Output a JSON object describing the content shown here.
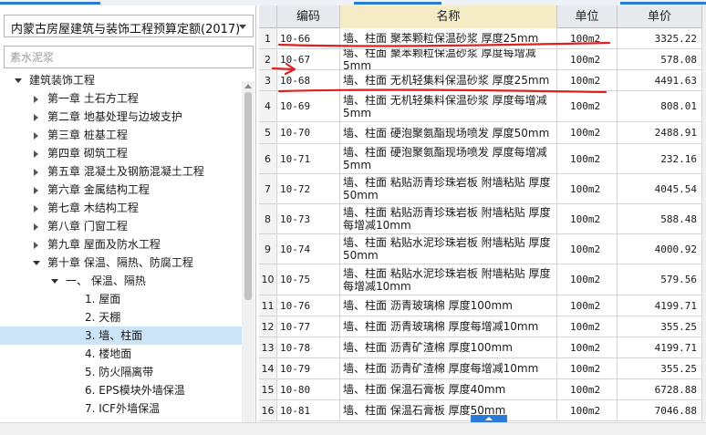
{
  "quota_selector": {
    "value": "内蒙古房屋建筑与装饰工程预算定额(2017)"
  },
  "search": {
    "placeholder": "素水泥浆"
  },
  "tree": {
    "root": "建筑装饰工程",
    "chapters": [
      "第一章 土石方工程",
      "第二章 地基处理与边坡支护",
      "第三章 桩基工程",
      "第四章 砌筑工程",
      "第五章 混凝土及钢筋混凝土工程",
      "第六章 金属结构工程",
      "第七章 木结构工程",
      "第八章 门窗工程",
      "第九章 屋面及防水工程",
      "第十章 保温、隔热、防腐工程"
    ],
    "section": "一、 保温、隔热",
    "items": [
      "1. 屋面",
      "2. 天棚",
      "3. 墙、柱面",
      "4. 楼地面",
      "5. 防火隔离带",
      "6. EPS模块外墙保温",
      "7. ICF外墙保温"
    ]
  },
  "grid": {
    "headers": {
      "code": "编码",
      "name": "名称",
      "unit": "单位",
      "price": "单价"
    },
    "rows": [
      {
        "idx": "1",
        "code": "10-66",
        "name": "墙、柱面 聚苯颗粒保温砂浆 厚度25mm",
        "unit": "100m2",
        "price": "3325.22"
      },
      {
        "idx": "2",
        "code": "10-67",
        "name": "墙、柱面 聚苯颗粒保温砂浆 厚度每增减5mm",
        "unit": "100m2",
        "price": "578.08"
      },
      {
        "idx": "3",
        "code": "10-68",
        "name": "墙、柱面 无机轻集料保温砂浆 厚度25mm",
        "unit": "100m2",
        "price": "4491.63"
      },
      {
        "idx": "4",
        "code": "10-69",
        "name": "墙、柱面 无机轻集料保温砂浆 厚度每增减5mm",
        "unit": "100m2",
        "price": "808.01"
      },
      {
        "idx": "5",
        "code": "10-70",
        "name": "墙、柱面 硬泡聚氨酯现场喷发 厚度50mm",
        "unit": "100m2",
        "price": "2488.91"
      },
      {
        "idx": "6",
        "code": "10-71",
        "name": "墙、柱面 硬泡聚氨酯现场喷发 厚度每增减5mm",
        "unit": "100m2",
        "price": "232.16"
      },
      {
        "idx": "7",
        "code": "10-72",
        "name": "墙、柱面 粘贴沥青珍珠岩板 附墙粘贴 厚度50mm",
        "unit": "100m2",
        "price": "4045.54"
      },
      {
        "idx": "8",
        "code": "10-73",
        "name": "墙、柱面 粘贴沥青珍珠岩板 附墙粘贴 厚度每增减10mm",
        "unit": "100m2",
        "price": "588.48"
      },
      {
        "idx": "9",
        "code": "10-74",
        "name": "墙、柱面 粘贴水泥珍珠岩板 附墙粘贴 厚度50mm",
        "unit": "100m2",
        "price": "4000.92"
      },
      {
        "idx": "10",
        "code": "10-75",
        "name": "墙、柱面 粘贴水泥珍珠岩板 附墙粘贴 厚度每增减10mm",
        "unit": "100m2",
        "price": "579.56"
      },
      {
        "idx": "11",
        "code": "10-76",
        "name": "墙、柱面 沥青玻璃棉 厚度100mm",
        "unit": "100m2",
        "price": "4199.71"
      },
      {
        "idx": "12",
        "code": "10-77",
        "name": "墙、柱面 沥青玻璃棉 厚度每增减10mm",
        "unit": "100m2",
        "price": "355.25"
      },
      {
        "idx": "13",
        "code": "10-78",
        "name": "墙、柱面 沥青矿渣棉 厚度100mm",
        "unit": "100m2",
        "price": "4199.71"
      },
      {
        "idx": "14",
        "code": "10-79",
        "name": "墙、柱面 沥青矿渣棉 厚度每增减10mm",
        "unit": "100m2",
        "price": "355.25"
      },
      {
        "idx": "15",
        "code": "10-80",
        "name": "墙、柱面 保温石膏板 厚度40mm",
        "unit": "100m2",
        "price": "6728.88"
      },
      {
        "idx": "16",
        "code": "10-81",
        "name": "墙、柱面 保温石膏板 厚度50mm",
        "unit": "100m2",
        "price": "7046.88"
      }
    ]
  },
  "colors": {
    "accent": "#2b7bd6",
    "annotation": "#e02020",
    "selection": "#cce4f7",
    "header_name_bg": "#f5ecc6"
  }
}
